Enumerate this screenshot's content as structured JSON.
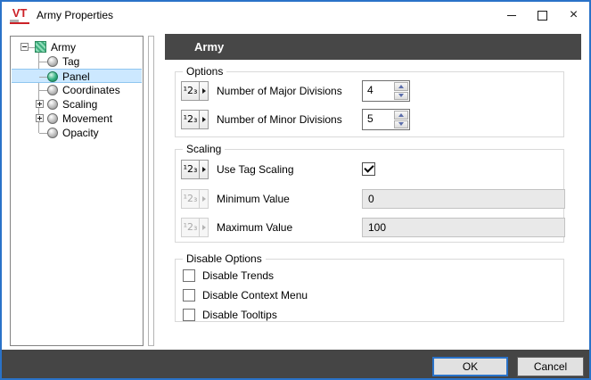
{
  "window": {
    "title": "Army Properties",
    "logo": "VT"
  },
  "titlebar": {
    "close_glyph": "×"
  },
  "tree": {
    "selected": "Panel",
    "items": [
      {
        "label": "Army"
      },
      {
        "label": "Tag"
      },
      {
        "label": "Panel"
      },
      {
        "label": "Coordinates"
      },
      {
        "label": "Scaling"
      },
      {
        "label": "Movement"
      },
      {
        "label": "Opacity"
      }
    ]
  },
  "panel": {
    "header": "Army",
    "groups": [
      {
        "title": "Options",
        "rows": [
          {
            "label": "Number of Major Divisions",
            "value": "4"
          },
          {
            "label": "Number of Minor Divisions",
            "value": "5"
          }
        ]
      },
      {
        "title": "Scaling",
        "rows": [
          {
            "label": "Use Tag Scaling",
            "checked": "yes"
          },
          {
            "label": "Minimum Value",
            "value": "0",
            "state": "disabled"
          },
          {
            "label": "Maximum Value",
            "value": "100",
            "state": "disabled"
          }
        ]
      },
      {
        "title": "Disable Options",
        "rows": [
          {
            "label": "Disable Trends",
            "checked": "no"
          },
          {
            "label": "Disable Context Menu",
            "checked": "no"
          },
          {
            "label": "Disable Tooltips",
            "checked": "no"
          }
        ]
      }
    ]
  },
  "footer": {
    "ok": "OK",
    "cancel": "Cancel"
  },
  "icons": {
    "numeric": "¹2₃",
    "check": "css-checkmark",
    "dropdown_arrow": "css-triangle-right",
    "spin_up": "css-triangle-up",
    "spin_down": "css-triangle-down"
  },
  "colors": {
    "accent_blue": "#2a72c8",
    "header_dark": "#474747",
    "selection_blue": "#cce8ff",
    "disabled_bg": "#e9e9e9",
    "sphere_green": "#35b183",
    "logo_red": "#cc2127"
  }
}
